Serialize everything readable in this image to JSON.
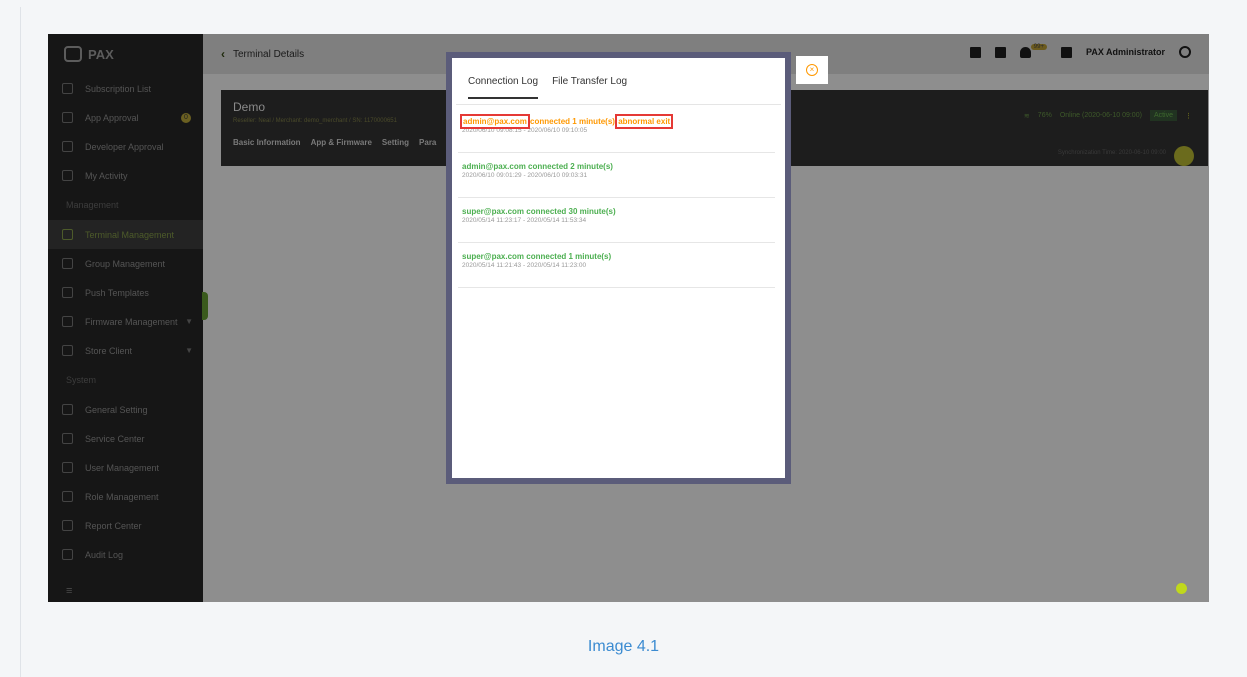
{
  "caption": "Image 4.1",
  "app": {
    "logo_text": "PAX"
  },
  "sidebar": {
    "items": [
      {
        "label": "Subscription List"
      },
      {
        "label": "App Approval",
        "badge": "0"
      },
      {
        "label": "Developer Approval"
      },
      {
        "label": "My Activity"
      }
    ],
    "section_management": "Management",
    "management_items": [
      {
        "label": "Terminal Management"
      },
      {
        "label": "Group Management"
      },
      {
        "label": "Push Templates"
      },
      {
        "label": "Firmware Management"
      },
      {
        "label": "Store Client"
      }
    ],
    "section_system": "System",
    "system_items": [
      {
        "label": "General Setting"
      },
      {
        "label": "Service Center"
      },
      {
        "label": "User Management"
      },
      {
        "label": "Role Management"
      },
      {
        "label": "Report Center"
      },
      {
        "label": "Audit Log"
      }
    ],
    "footer_icon": "≡"
  },
  "header": {
    "title": "Terminal Details",
    "back_icon": "‹",
    "notification_badge": "99+",
    "user_name": "PAX Administrator"
  },
  "terminal": {
    "name": "Demo",
    "meta": "Reseller: Neal  /  Merchant: demo_merchant  /  SN: 1170000651",
    "tabs": [
      "Basic Information",
      "App & Firmware",
      "Setting",
      "Para"
    ],
    "battery": "76%",
    "online": "Online (2020-06-10 09:00)",
    "status": "Active",
    "sync_time": "Synchronization Time: 2020-06-10 09:00"
  },
  "modal": {
    "tabs": [
      "Connection Log",
      "File Transfer Log"
    ],
    "logs": [
      {
        "user": "admin@pax.com",
        "action": " connected 1 minute(s) ",
        "tag": "abnormal exit",
        "time": "2020/06/10 09:08:15 - 2020/06/10 09:10:05",
        "status_color": "#ff9800"
      },
      {
        "user": "admin@pax.com",
        "action": " connected 2 minute(s)",
        "tag": "",
        "time": "2020/06/10 09:01:29 - 2020/06/10 09:03:31",
        "status_color": "#4caf50"
      },
      {
        "user": "super@pax.com",
        "action": " connected 30 minute(s)",
        "tag": "",
        "time": "2020/05/14 11:23:17 - 2020/05/14 11:53:34",
        "status_color": "#4caf50"
      },
      {
        "user": "super@pax.com",
        "action": " connected 1 minute(s)",
        "tag": "",
        "time": "2020/05/14 11:21:43 - 2020/05/14 11:23:00",
        "status_color": "#4caf50"
      }
    ]
  },
  "colors": {
    "highlight": "#e53935",
    "warn": "#ff9800",
    "success": "#4caf50",
    "caption": "#3b8bd1"
  }
}
